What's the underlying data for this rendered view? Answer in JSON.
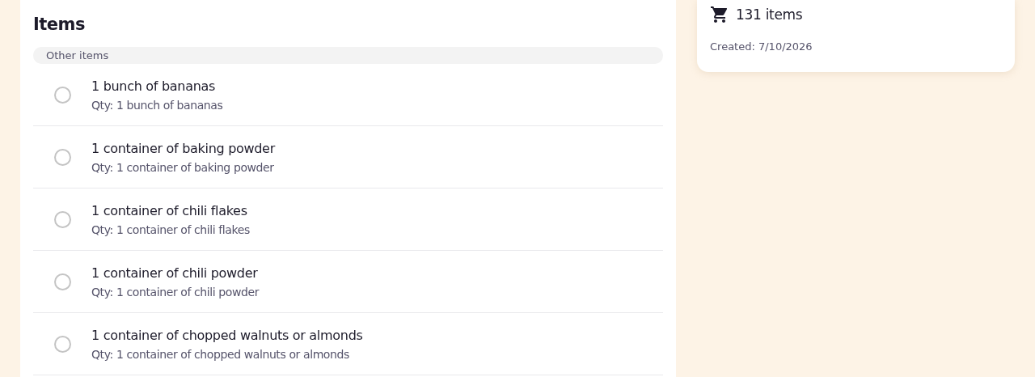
{
  "items_panel": {
    "title": "Items",
    "group": {
      "label": "Other items",
      "items": [
        {
          "name": "1 bunch of bananas",
          "qty": "Qty: 1 bunch of bananas",
          "checked": false
        },
        {
          "name": "1 container of baking powder",
          "qty": "Qty: 1 container of baking powder",
          "checked": false
        },
        {
          "name": "1 container of chili flakes",
          "qty": "Qty: 1 container of chili flakes",
          "checked": false
        },
        {
          "name": "1 container of chili powder",
          "qty": "Qty: 1 container of chili powder",
          "checked": false
        },
        {
          "name": "1 container of chopped walnuts or almonds",
          "qty": "Qty: 1 container of chopped walnuts or almonds",
          "checked": false
        }
      ]
    }
  },
  "summary": {
    "count": "131 items",
    "created": "Created: 7/10/2026"
  }
}
